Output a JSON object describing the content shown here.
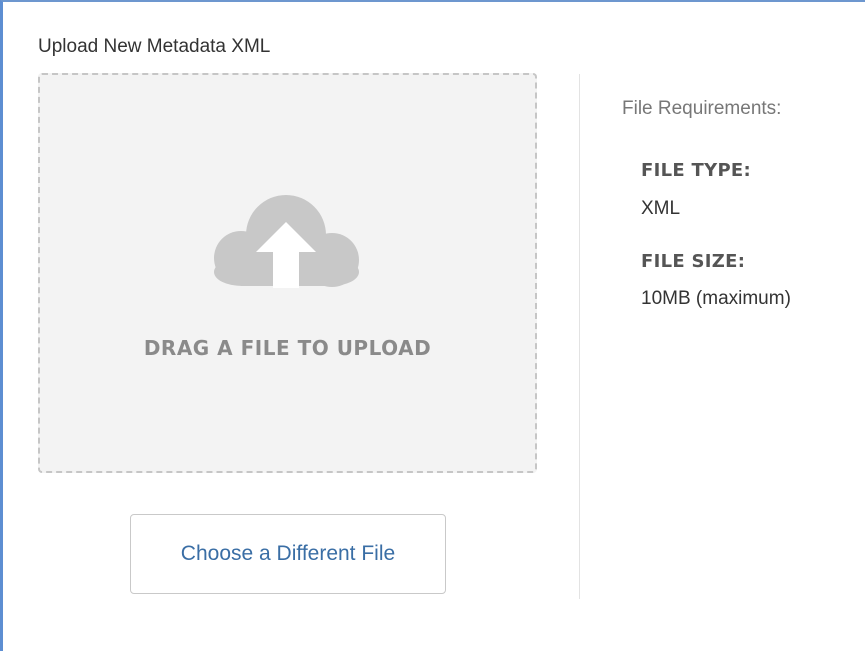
{
  "upload": {
    "title": "Upload New Metadata XML",
    "dropzone_label": "DRAG A FILE TO UPLOAD",
    "dropzone_icon": "cloud-upload-icon",
    "choose_button_label": "Choose a Different File"
  },
  "requirements": {
    "heading": "File Requirements:",
    "items": [
      {
        "label": "FILE TYPE:",
        "value": "XML"
      },
      {
        "label": "FILE SIZE:",
        "value": "10MB (maximum)"
      }
    ]
  },
  "colors": {
    "accent_border": "#5d8ed2",
    "button_text": "#3a6ea5",
    "dropzone_bg": "#f3f3f3",
    "icon_gray": "#c8c8c8"
  }
}
